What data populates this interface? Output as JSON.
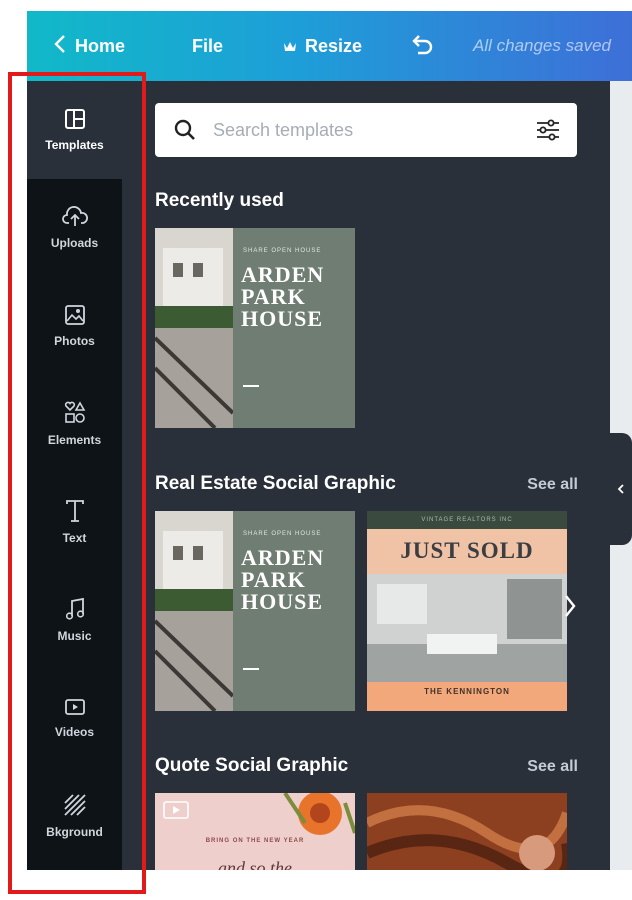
{
  "topbar": {
    "home_label": "Home",
    "file_label": "File",
    "resize_label": "Resize",
    "status": "All changes saved"
  },
  "sidebar": {
    "items": [
      {
        "label": "Templates",
        "icon": "templates-icon",
        "active": true
      },
      {
        "label": "Uploads",
        "icon": "upload-cloud-icon"
      },
      {
        "label": "Photos",
        "icon": "photo-icon"
      },
      {
        "label": "Elements",
        "icon": "shapes-icon"
      },
      {
        "label": "Text",
        "icon": "text-icon"
      },
      {
        "label": "Music",
        "icon": "music-note-icon"
      },
      {
        "label": "Videos",
        "icon": "video-play-icon"
      },
      {
        "label": "Bkground",
        "icon": "background-hatch-icon"
      }
    ]
  },
  "search": {
    "placeholder": "Search templates",
    "value": ""
  },
  "sections": [
    {
      "title": "Recently used",
      "see_all": "",
      "templates": [
        {
          "title": "ARDEN PARK HOUSE",
          "small_text": "SHARE OPEN HOUSE"
        }
      ]
    },
    {
      "title": "Real Estate Social Graphic",
      "see_all": "See all",
      "templates": [
        {
          "title": "ARDEN PARK HOUSE",
          "small_text": "SHARE OPEN HOUSE"
        },
        {
          "title": "JUST SOLD",
          "small_text": "VINTAGE REALTORS INC",
          "name": "THE KENNINGTON"
        }
      ]
    },
    {
      "title": "Quote Social Graphic",
      "see_all": "See all",
      "templates": [
        {
          "small_text": "BRING ON THE NEW YEAR",
          "big_text": "and so the"
        },
        {}
      ]
    }
  ],
  "colors": {
    "topbar_start": "#11b9c8",
    "topbar_end": "#3e6fd8",
    "sidebar_bg": "#0e1318",
    "panel_bg": "#293039",
    "highlight": "#e11b1b"
  }
}
